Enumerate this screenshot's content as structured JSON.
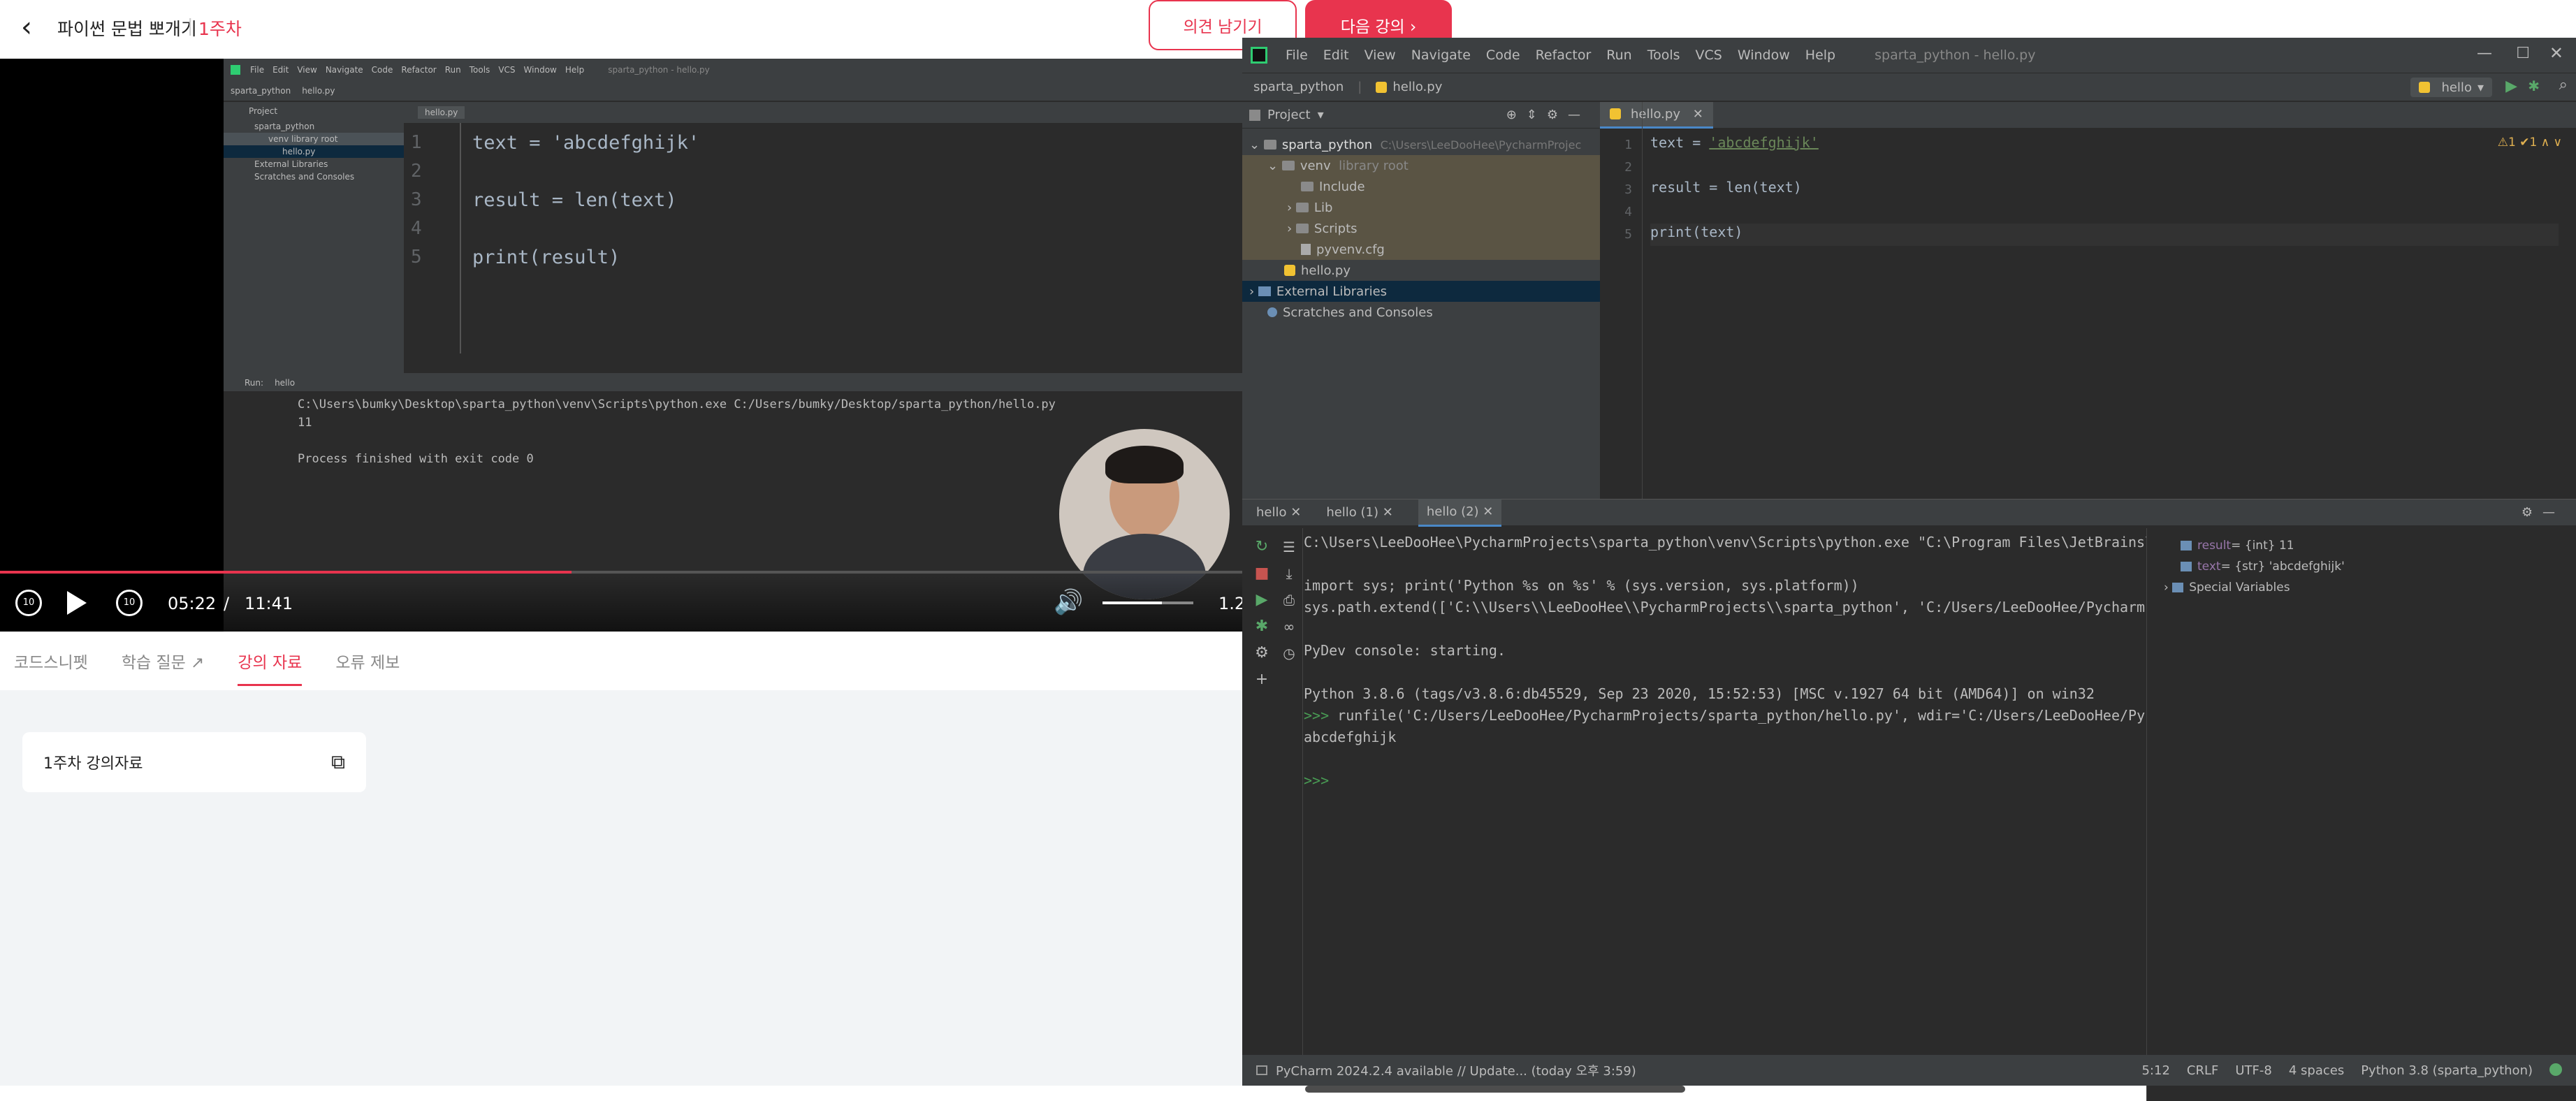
{
  "lecture": {
    "title": "파이썬 문법 뽀개기",
    "week": "1주차",
    "feedback_btn": "의견 남기기",
    "next_btn": "다음 강의 ›"
  },
  "video_ide": {
    "menu": [
      "File",
      "Edit",
      "View",
      "Navigate",
      "Code",
      "Refactor",
      "Run",
      "Tools",
      "VCS",
      "Window",
      "Help"
    ],
    "title": "sparta_python - hello.py",
    "breadcrumb": "sparta_python",
    "file": "hello.py",
    "project_label": "Project",
    "tree": [
      "sparta_python",
      "venv  library root",
      "hello.py",
      "External Libraries",
      "Scratches and Consoles"
    ],
    "code": [
      "text = 'abcdefghijk'",
      "",
      "result = len(text)",
      "",
      "print(result)"
    ],
    "run_label": "Run:",
    "run_tab": "hello",
    "run_cmd": "C:\\Users\\bumky\\Desktop\\sparta_python\\venv\\Scripts\\python.exe C:/Users/bumky/Desktop/sparta_python/hello.py",
    "run_out": "11",
    "run_exit": "Process finished with exit code 0"
  },
  "player": {
    "current": "05:22",
    "separator": "/",
    "total": "11:41",
    "speed": "1.2",
    "progress": 0.46
  },
  "tabs": [
    {
      "label": "코드스니펫"
    },
    {
      "label": "학습 질문 ↗"
    },
    {
      "label": "강의 자료"
    },
    {
      "label": "오류 제보"
    }
  ],
  "material": {
    "card_title": "1주차 강의자료"
  },
  "pycharm": {
    "menu": [
      "File",
      "Edit",
      "View",
      "Navigate",
      "Code",
      "Refactor",
      "Run",
      "Tools",
      "VCS",
      "Window",
      "Help"
    ],
    "title": "sparta_python - hello.py",
    "breadcrumb": "sparta_python",
    "crumb_file": "hello.py",
    "run_config": "hello",
    "project_label": "Project",
    "tree": {
      "root": "sparta_python",
      "root_path": "C:\\Users\\LeeDooHee\\PycharmProjec",
      "venv": "venv",
      "venv_hint": "library root",
      "include": "Include",
      "lib": "Lib",
      "scripts": "Scripts",
      "cfg": "pyvenv.cfg",
      "hello": "hello.py",
      "ext": "External Libraries",
      "scratch": "Scratches and Consoles"
    },
    "editor_tab": "hello.py",
    "line_numbers": [
      "1",
      "2",
      "3",
      "4",
      "5"
    ],
    "code": {
      "l1a": "text = ",
      "l1b": "'abcdefghijk'",
      "l3": "result = len(text)",
      "l5": "print(text)"
    },
    "inspect": "⚠1 ✔1 ∧ ∨",
    "run_tabs": [
      "hello",
      "hello (1)",
      "hello (2)"
    ],
    "console": [
      "C:\\Users\\LeeDooHee\\PycharmProjects\\sparta_python\\venv\\Scripts\\python.exe \"C:\\Program Files\\JetBrains\\",
      "",
      "import sys; print('Python %s on %s' % (sys.version, sys.platform))",
      "sys.path.extend(['C:\\\\Users\\\\LeeDooHee\\\\PycharmProjects\\\\sparta_python', 'C:/Users/LeeDooHee/Pycharm",
      "",
      "PyDev console: starting.",
      "",
      "Python 3.8.6 (tags/v3.8.6:db45529, Sep 23 2020, 15:52:53) [MSC v.1927 64 bit (AMD64)] on win32"
    ],
    "runfile_prompt": ">>> ",
    "runfile": "runfile('C:/Users/LeeDooHee/PycharmProjects/sparta_python/hello.py', wdir='C:/Users/LeeDooHee/Pyc",
    "output": "abcdefghijk",
    "end_prompt": ">>>",
    "vars": [
      {
        "name": "result",
        "val": " = {int} 11"
      },
      {
        "name": "text",
        "val": " = {str} 'abcdefghijk'"
      }
    ],
    "special_vars": "Special Variables",
    "status_left": "PyCharm 2024.2.4 available // Update... (today 오후 3:59)",
    "status_right": [
      "5:12",
      "CRLF",
      "UTF-8",
      "4 spaces",
      "Python 3.8 (sparta_python)"
    ]
  }
}
